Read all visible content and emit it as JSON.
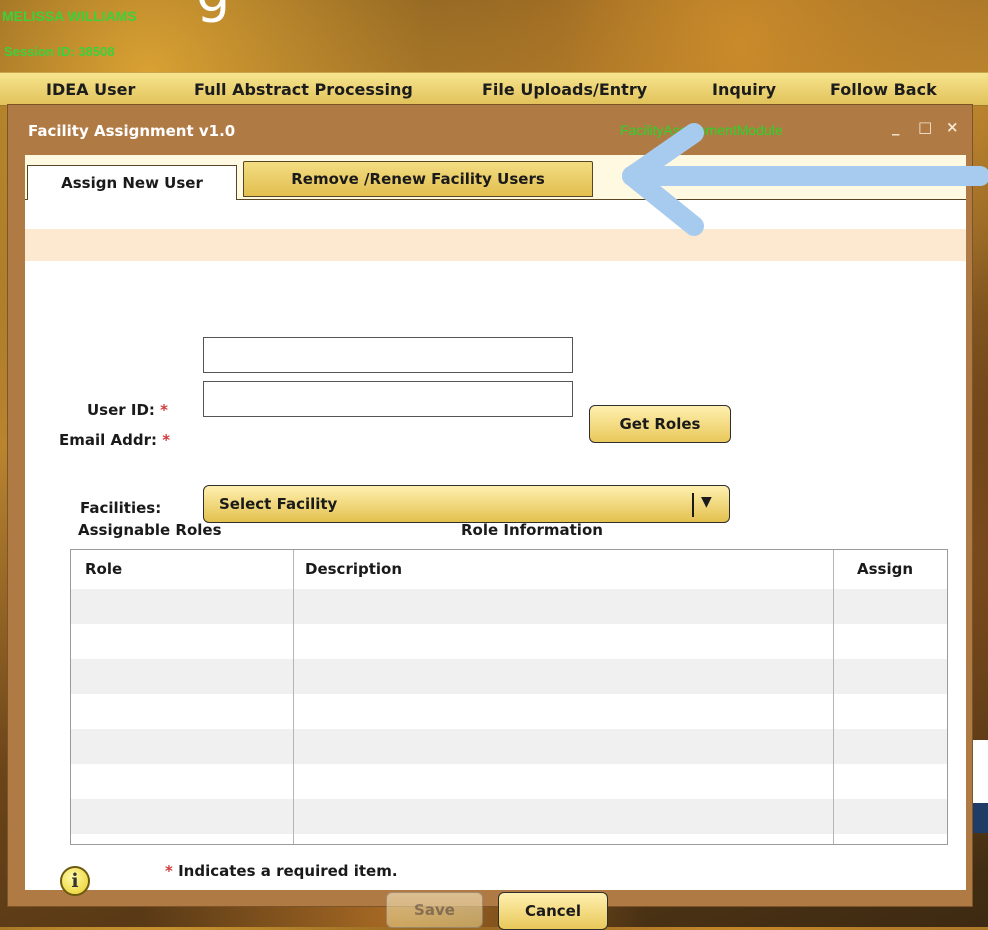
{
  "page": {
    "title_fragment": "g",
    "user_name": "MELISSA WILLIAMS",
    "session_label": "Session ID: 38508"
  },
  "menu": {
    "items": [
      {
        "label": "IDEA User"
      },
      {
        "label": "Full Abstract Processing"
      },
      {
        "label": "File Uploads/Entry"
      },
      {
        "label": "Inquiry"
      },
      {
        "label": "Follow Back"
      }
    ]
  },
  "window": {
    "title": "Facility Assignment v1.0",
    "module_name": "FacilityAssignmentModule",
    "controls": {
      "minimize": "_",
      "maximize": "□",
      "close": "×"
    }
  },
  "tabs": [
    {
      "label": "Assign New User",
      "active": true
    },
    {
      "label": "Remove /Renew Facility Users",
      "active": false
    }
  ],
  "form": {
    "user_id_label": "User ID:",
    "email_label": "Email Addr:",
    "required_mark": "*",
    "user_id_value": "",
    "email_value": "",
    "get_roles_label": "Get Roles",
    "facilities_label": "Facilities:",
    "facility_selected": "Select Facility",
    "dropdown_arrow": "▼"
  },
  "roles": {
    "assignable_title": "Assignable Roles",
    "info_title": "Role Information",
    "columns": [
      "Role",
      "Description",
      "Assign"
    ],
    "rows": [
      [
        "",
        "",
        ""
      ],
      [
        "",
        "",
        ""
      ],
      [
        "",
        "",
        ""
      ],
      [
        "",
        "",
        ""
      ],
      [
        "",
        "",
        ""
      ],
      [
        "",
        "",
        ""
      ],
      [
        "",
        "",
        ""
      ]
    ]
  },
  "footer": {
    "info_glyph": "i",
    "required_mark": "*",
    "required_note": "Indicates a required item.",
    "save_label": "Save",
    "cancel_label": "Cancel"
  },
  "colors": {
    "accent_gold": "#e9c85a",
    "window_frame": "#b07a44",
    "session_green": "#3bd13b",
    "required_red": "#d23b3b",
    "annotation_arrow": "#a7cbef"
  },
  "icons": [
    "info-icon",
    "dropdown-arrow-icon",
    "minimize-icon",
    "maximize-icon",
    "close-icon",
    "annotation-arrow-icon"
  ]
}
